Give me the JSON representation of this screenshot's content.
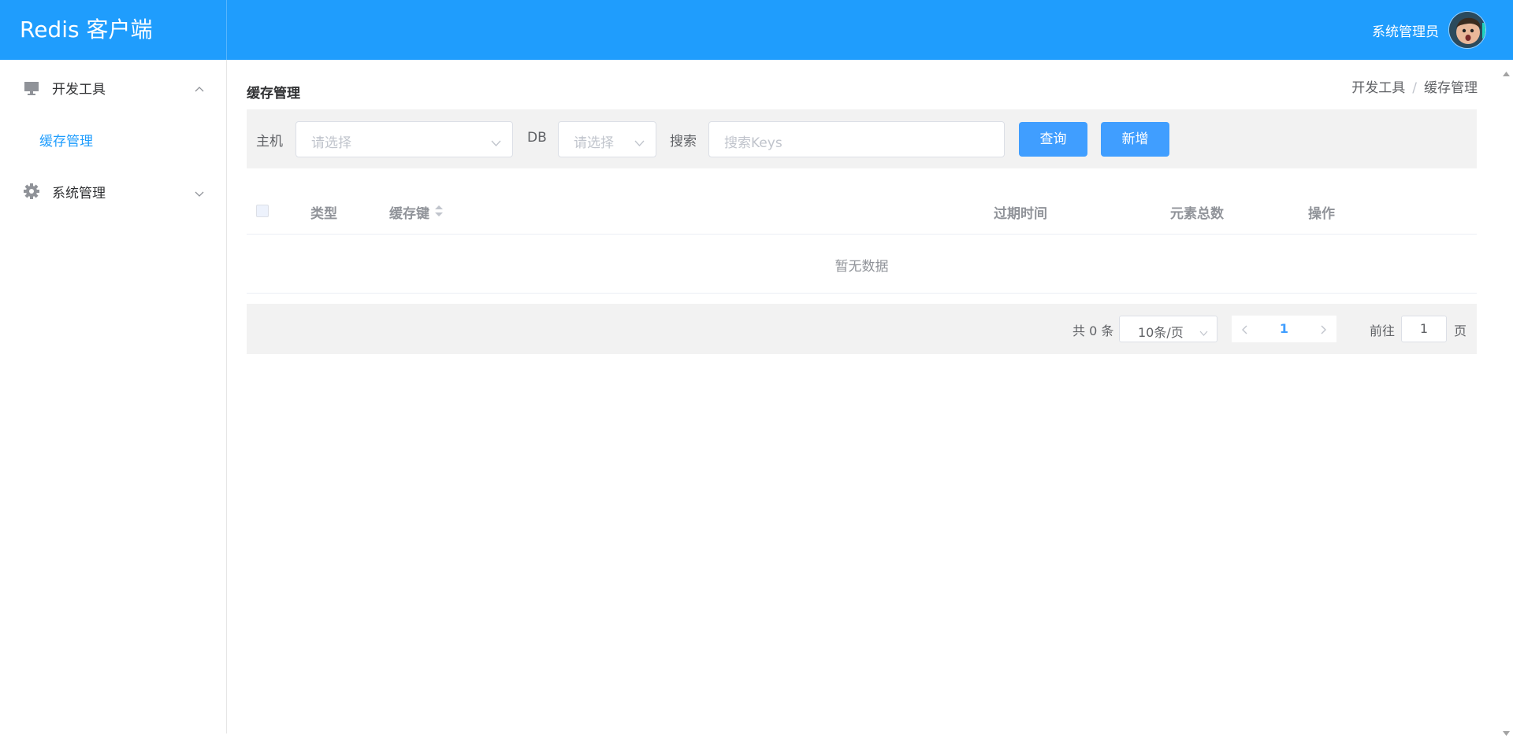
{
  "header": {
    "brand": "Redis 客户端",
    "user_name": "系统管理员"
  },
  "sidebar": {
    "groups": [
      {
        "label": "开发工具",
        "icon": "monitor-icon",
        "expanded": true,
        "items": [
          {
            "label": "缓存管理",
            "active": true
          }
        ]
      },
      {
        "label": "系统管理",
        "icon": "gear-icon",
        "expanded": false,
        "items": []
      }
    ]
  },
  "main": {
    "title": "缓存管理",
    "breadcrumb": [
      "开发工具",
      "缓存管理"
    ],
    "breadcrumb_sep": "/"
  },
  "filter": {
    "host_label": "主机",
    "host_placeholder": "请选择",
    "db_label": "DB",
    "db_placeholder": "请选择",
    "search_label": "搜索",
    "search_placeholder": "搜索Keys",
    "query_button": "查询",
    "add_button": "新增"
  },
  "table": {
    "columns": [
      "类型",
      "缓存键",
      "过期时间",
      "元素总数",
      "操作"
    ],
    "empty_text": "暂无数据"
  },
  "pagination": {
    "total_text": "共 0 条",
    "page_size": "10条/页",
    "current_page": "1",
    "goto_label": "前往",
    "goto_value": "1",
    "goto_unit": "页"
  },
  "colors": {
    "header_bg": "#1f9dfd",
    "primary": "#409eff"
  }
}
